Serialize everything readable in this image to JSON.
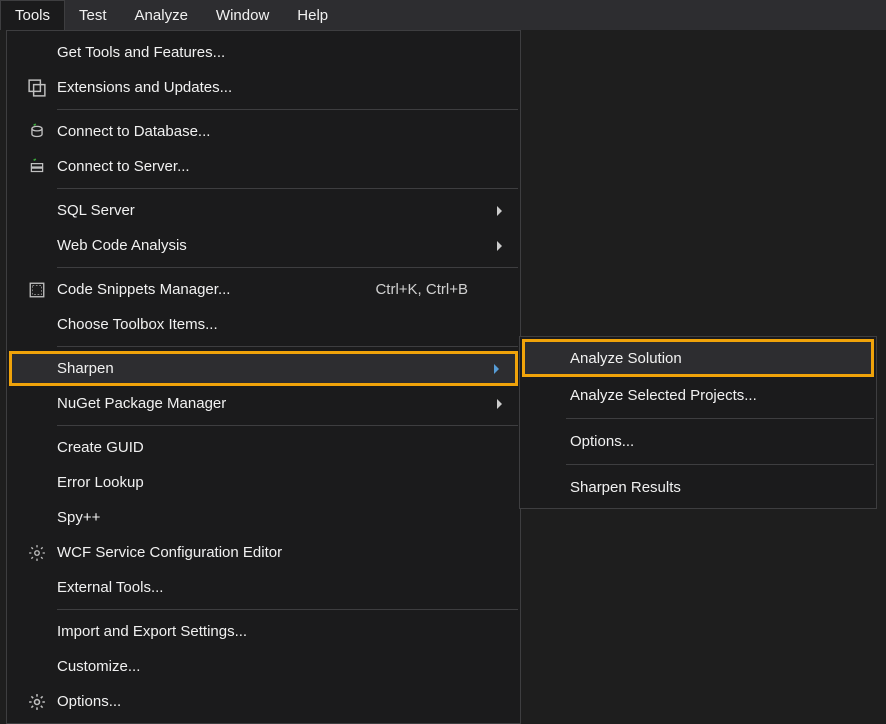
{
  "menubar": {
    "items": [
      {
        "label": "Tools",
        "active": true
      },
      {
        "label": "Test",
        "active": false
      },
      {
        "label": "Analyze",
        "active": false
      },
      {
        "label": "Window",
        "active": false
      },
      {
        "label": "Help",
        "active": false
      }
    ]
  },
  "tools_menu": {
    "get_tools": "Get Tools and Features...",
    "extensions": "Extensions and Updates...",
    "connect_db": "Connect to Database...",
    "connect_server": "Connect to Server...",
    "sql_server": "SQL Server",
    "web_code_analysis": "Web Code Analysis",
    "code_snippets": "Code Snippets Manager...",
    "code_snippets_shortcut": "Ctrl+K, Ctrl+B",
    "choose_toolbox": "Choose Toolbox Items...",
    "sharpen": "Sharpen",
    "nuget": "NuGet Package Manager",
    "create_guid": "Create GUID",
    "error_lookup": "Error Lookup",
    "spypp": "Spy++",
    "wcf_editor": "WCF Service Configuration Editor",
    "external_tools": "External Tools...",
    "import_export": "Import and Export Settings...",
    "customize": "Customize...",
    "options": "Options..."
  },
  "sharpen_submenu": {
    "analyze_solution": "Analyze Solution",
    "analyze_selected": "Analyze Selected Projects...",
    "options": "Options...",
    "results": "Sharpen Results"
  }
}
